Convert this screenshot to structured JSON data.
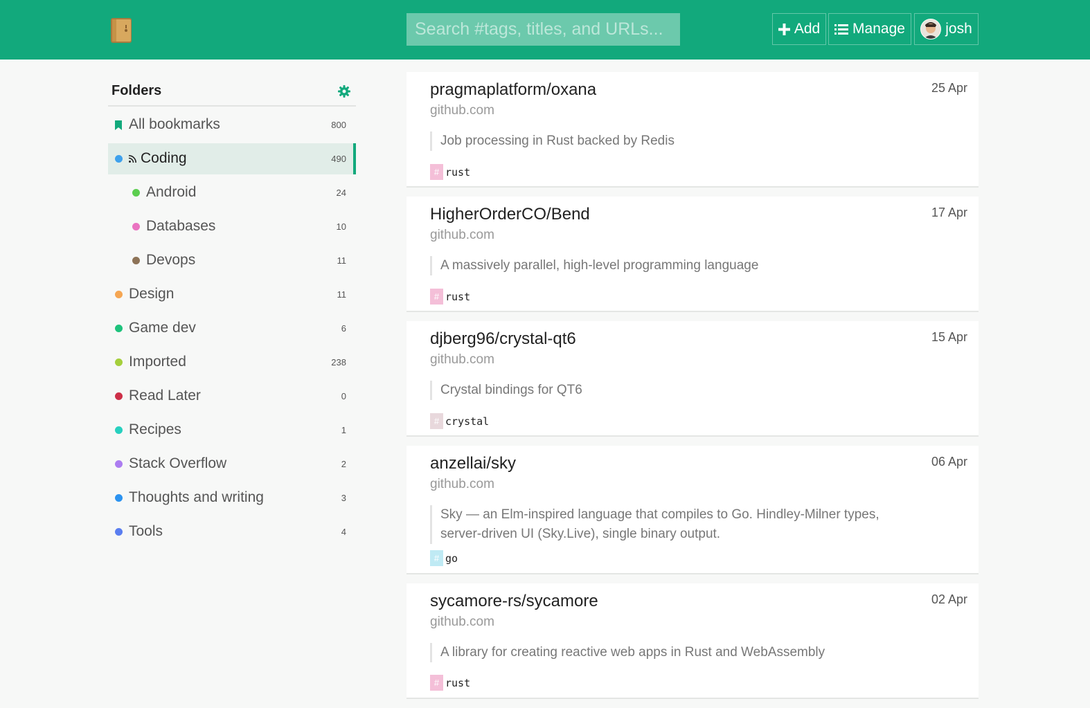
{
  "header": {
    "search_placeholder": "Search #tags, titles, and URLs...",
    "add_label": "Add",
    "manage_label": "Manage",
    "user_name": "josh",
    "bg_color": "#12a97c"
  },
  "sidebar": {
    "title": "Folders",
    "items": [
      {
        "label": "All bookmarks",
        "count": "800",
        "icon": "bookmark-icon"
      },
      {
        "label": "Coding",
        "count": "490",
        "color": "#3ea1ec",
        "icon": "rss-icon",
        "active": true
      },
      {
        "label": "Android",
        "count": "24",
        "color": "#5cce50"
      },
      {
        "label": "Databases",
        "count": "10",
        "color": "#ea73c1"
      },
      {
        "label": "Devops",
        "count": "11",
        "color": "#8d7357"
      },
      {
        "label": "Design",
        "count": "11",
        "color": "#f5a653"
      },
      {
        "label": "Game dev",
        "count": "6",
        "color": "#1ec27c"
      },
      {
        "label": "Imported",
        "count": "238",
        "color": "#a5cf3c"
      },
      {
        "label": "Read Later",
        "count": "0",
        "color": "#cd2f48"
      },
      {
        "label": "Recipes",
        "count": "1",
        "color": "#27d0bf"
      },
      {
        "label": "Stack Overflow",
        "count": "2",
        "color": "#ac7df0"
      },
      {
        "label": "Thoughts and writing",
        "count": "3",
        "color": "#2c93f0"
      },
      {
        "label": "Tools",
        "count": "4",
        "color": "#5a7ef0"
      }
    ]
  },
  "bookmarks": [
    {
      "title": "pragmaplatform/oxana",
      "domain": "github.com",
      "date": "25 Apr",
      "description": "Job processing in Rust backed by Redis",
      "tag": "rust",
      "tag_color": "#f4bfd8"
    },
    {
      "title": "HigherOrderCO/Bend",
      "domain": "github.com",
      "date": "17 Apr",
      "description": "A massively parallel, high-level programming language",
      "tag": "rust",
      "tag_color": "#f4bfd8"
    },
    {
      "title": "djberg96/crystal-qt6",
      "domain": "github.com",
      "date": "15 Apr",
      "description": "Crystal bindings for QT6",
      "tag": "crystal",
      "tag_color": "#e8d8dc"
    },
    {
      "title": "anzellai/sky",
      "domain": "github.com",
      "date": "06 Apr",
      "description": "Sky — an Elm-inspired language that compiles to Go. Hindley-Milner types, server-driven UI (Sky.Live), single binary output.",
      "tag": "go",
      "tag_color": "#bfeaf4"
    },
    {
      "title": "sycamore-rs/sycamore",
      "domain": "github.com",
      "date": "02 Apr",
      "description": "A library for creating reactive web apps in Rust and WebAssembly",
      "tag": "rust",
      "tag_color": "#f4bfd8"
    }
  ]
}
